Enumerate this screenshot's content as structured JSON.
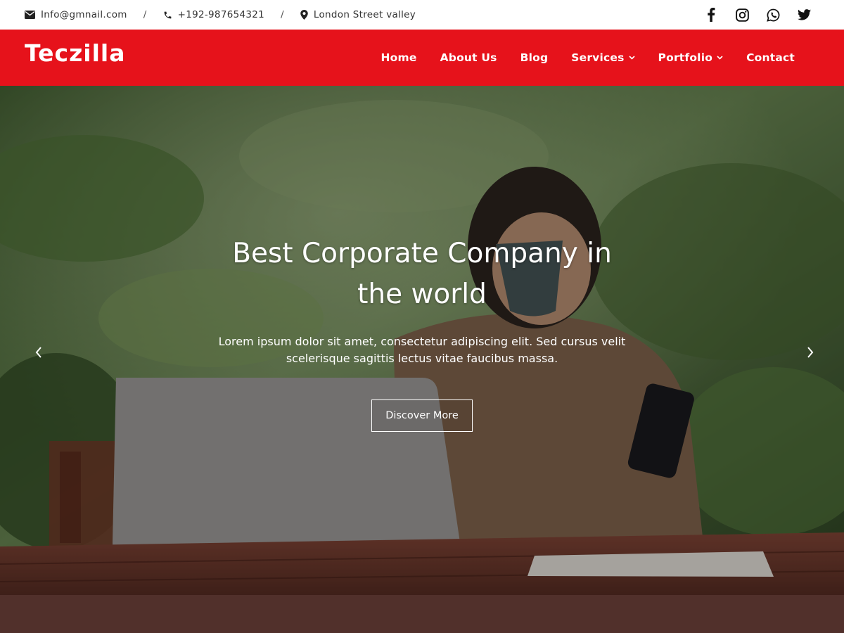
{
  "topbar": {
    "email": "Info@gmnail.com",
    "phone": "+192-987654321",
    "address": "London Street valley",
    "separator": "/",
    "icons": [
      "envelope-icon",
      "phone-icon",
      "map-pin-icon"
    ],
    "social": [
      "facebook-icon",
      "instagram-icon",
      "whatsapp-icon",
      "twitter-icon"
    ]
  },
  "navbar": {
    "brand": "Teczilla",
    "items": [
      {
        "label": "Home",
        "has_dropdown": false
      },
      {
        "label": "About Us",
        "has_dropdown": false
      },
      {
        "label": "Blog",
        "has_dropdown": false
      },
      {
        "label": "Services",
        "has_dropdown": true
      },
      {
        "label": "Portfolio",
        "has_dropdown": true
      },
      {
        "label": "Contact",
        "has_dropdown": false
      }
    ]
  },
  "hero": {
    "title": "Best Corporate Company in the world",
    "text": "Lorem ipsum dolor sit amet, consectetur adipiscing elit. Sed cursus velit scelerisque sagittis lectus vitae faucibus massa.",
    "button": "Discover More",
    "prev_icon": "chevron-left-icon",
    "next_icon": "chevron-right-icon"
  },
  "colors": {
    "primary": "#e6121b",
    "footer_band": "#51302b",
    "white": "#ffffff"
  }
}
